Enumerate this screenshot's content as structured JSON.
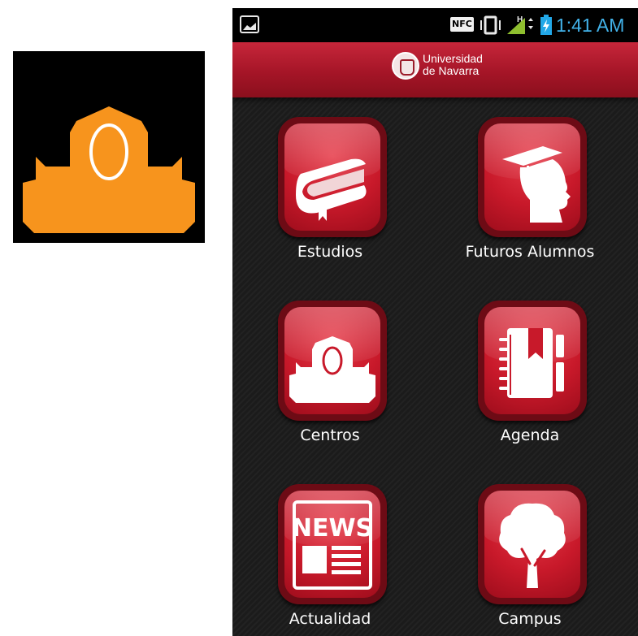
{
  "side_icon": {
    "name": "centros-orange-icon",
    "color": "#f7941d"
  },
  "statusbar": {
    "nfc_label": "NFC",
    "network_label": "H",
    "time": "1:41 AM",
    "time_color": "#42b2e9"
  },
  "header": {
    "logo_line1": "Universidad",
    "logo_line2": "de Navarra",
    "accent": "#b01e2f"
  },
  "menu": [
    {
      "label": "Estudios",
      "icon": "book-icon"
    },
    {
      "label": "Futuros Alumnos",
      "icon": "graduate-head-icon"
    },
    {
      "label": "Centros",
      "icon": "building-icon"
    },
    {
      "label": "Agenda",
      "icon": "notebook-icon"
    },
    {
      "label": "Actualidad",
      "icon": "newspaper-icon"
    },
    {
      "label": "Campus",
      "icon": "tree-icon"
    }
  ],
  "news_icon_text": "NEWS"
}
